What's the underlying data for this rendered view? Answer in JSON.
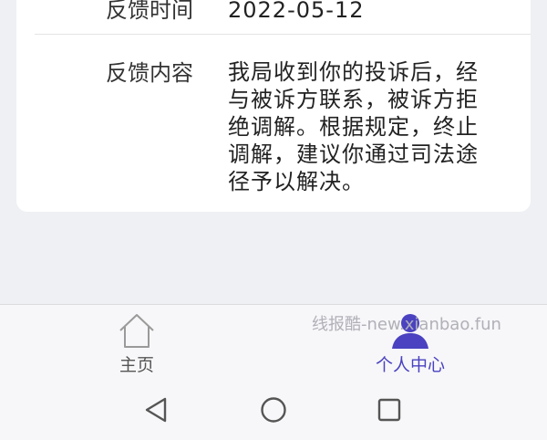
{
  "feedback": {
    "time_label": "反馈时间",
    "time_value": "2022-05-12",
    "content_label": "反馈内容",
    "content_lines": [
      "我局收到你的投诉后，经",
      "与被诉方联系，被诉方拒",
      "绝调解。根据规定，终止",
      "调解，建议你通过司法途",
      "径予以解决。"
    ]
  },
  "tabbar": {
    "home_label": "主页",
    "home_icon": "home-icon",
    "me_label": "个人中心",
    "me_icon": "person-icon",
    "active_color": "#4a42c0"
  },
  "watermark": "线报酷-new.xianbao.fun",
  "navbar": {
    "back_icon": "back-triangle-icon",
    "home_icon": "home-circle-icon",
    "recent_icon": "recent-square-icon"
  }
}
